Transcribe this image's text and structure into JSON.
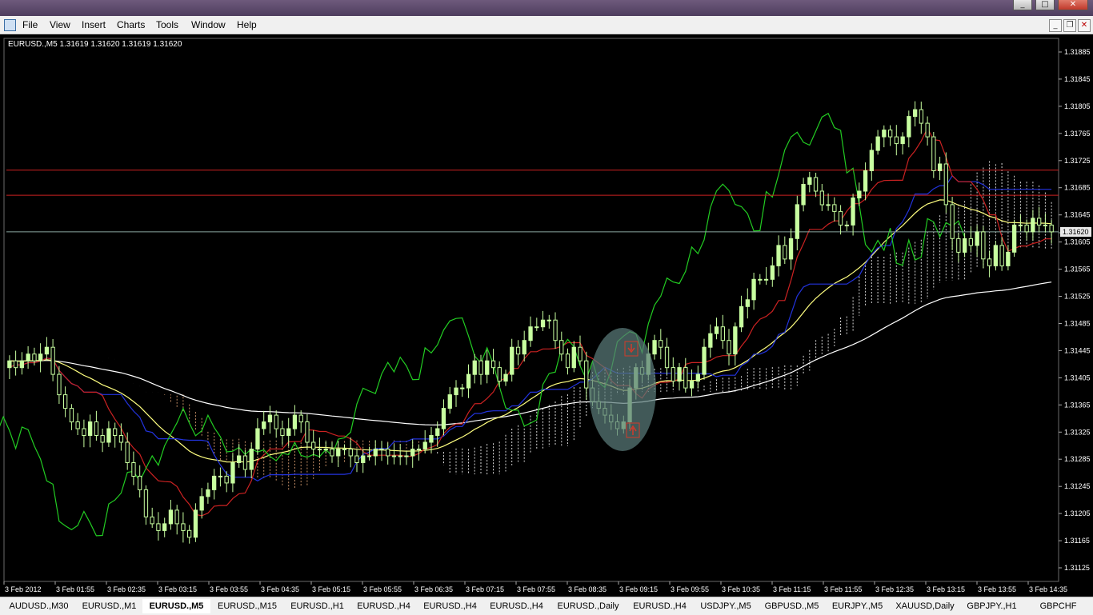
{
  "menu": [
    "File",
    "View",
    "Insert",
    "Charts",
    "Tools",
    "Window",
    "Help"
  ],
  "window_controls": {
    "minimize": "_",
    "maximize": "□",
    "close": "✕"
  },
  "mdi_controls": {
    "minimize": "_",
    "restore": "❐",
    "close": "✕"
  },
  "chart_header": "EURUSD.,M5  1.31619 1.31620 1.31619 1.31620",
  "price_axis": [
    "1.31885",
    "1.31845",
    "1.31805",
    "1.31765",
    "1.31725",
    "1.31685",
    "1.31645",
    "1.31605",
    "1.31565",
    "1.31525",
    "1.31485",
    "1.31445",
    "1.31405",
    "1.31365",
    "1.31325",
    "1.31285",
    "1.31245",
    "1.31205",
    "1.31165",
    "1.31125"
  ],
  "current_price": "1.31620",
  "horizontal_lines": [
    1.31711,
    1.31674
  ],
  "time_axis": [
    "3 Feb 2012",
    "3 Feb 01:55",
    "3 Feb 02:35",
    "3 Feb 03:15",
    "3 Feb 03:55",
    "3 Feb 04:35",
    "3 Feb 05:15",
    "3 Feb 05:55",
    "3 Feb 06:35",
    "3 Feb 07:15",
    "3 Feb 07:55",
    "3 Feb 08:35",
    "3 Feb 09:15",
    "3 Feb 09:55",
    "3 Feb 10:35",
    "3 Feb 11:15",
    "3 Feb 11:55",
    "3 Feb 12:35",
    "3 Feb 13:15",
    "3 Feb 13:55",
    "3 Feb 14:35"
  ],
  "tabs": [
    "AUDUSD.,M30",
    "EURUSD.,M1",
    "EURUSD.,M5",
    "EURUSD.,M15",
    "EURUSD.,H1",
    "EURUSD.,H4",
    "EURUSD.,H4",
    "EURUSD.,H4",
    "EURUSD.,Daily",
    "EURUSD.,H4",
    "USDJPY.,M5",
    "GBPUSD.,M5",
    "EURJPY.,M5",
    "XAUUSD,Daily",
    "GBPJPY.,H1",
    "GBPCHF"
  ],
  "active_tab": 2,
  "colors": {
    "background": "#000000",
    "bull_candle": "#c8ffa0",
    "chikou": "#22cc22",
    "tenkan": "#cc2222",
    "kijun": "#2233dd",
    "ma_fast": "#ffff80",
    "ma_slow": "#ffffff",
    "hline": "#cc2222",
    "current_price_line": "#8aa6a0"
  },
  "chart_data": {
    "type": "candlestick",
    "symbol": "EURUSD.",
    "timeframe": "M5",
    "ylim": [
      1.31105,
      1.31905
    ],
    "last_price": 1.3162,
    "closes": [
      1.3143,
      1.3142,
      1.3143,
      1.3144,
      1.3143,
      1.3144,
      1.3145,
      1.3141,
      1.3138,
      1.3136,
      1.3134,
      1.3133,
      1.3132,
      1.3134,
      1.3132,
      1.3131,
      1.3133,
      1.3132,
      1.3131,
      1.3128,
      1.3126,
      1.3124,
      1.312,
      1.3119,
      1.3118,
      1.3119,
      1.3121,
      1.3119,
      1.3118,
      1.3117,
      1.3121,
      1.3123,
      1.3124,
      1.3126,
      1.3126,
      1.3125,
      1.3128,
      1.3129,
      1.3127,
      1.313,
      1.3133,
      1.3134,
      1.3135,
      1.3133,
      1.3132,
      1.3133,
      1.3135,
      1.3134,
      1.3131,
      1.313,
      1.313,
      1.313,
      1.3129,
      1.313,
      1.313,
      1.3129,
      1.3128,
      1.3129,
      1.3129,
      1.313,
      1.313,
      1.3129,
      1.3129,
      1.3129,
      1.3129,
      1.313,
      1.313,
      1.3131,
      1.3132,
      1.3133,
      1.3136,
      1.3138,
      1.3139,
      1.3139,
      1.3141,
      1.3143,
      1.3141,
      1.3143,
      1.3142,
      1.314,
      1.3141,
      1.3145,
      1.3144,
      1.3146,
      1.3148,
      1.3148,
      1.3149,
      1.3149,
      1.3146,
      1.3144,
      1.3142,
      1.3145,
      1.3143,
      1.3139,
      1.3137,
      1.3136,
      1.3135,
      1.3134,
      1.3133,
      1.3134,
      1.3139,
      1.3142,
      1.3141,
      1.3144,
      1.3146,
      1.3145,
      1.3142,
      1.314,
      1.3142,
      1.3139,
      1.314,
      1.3141,
      1.3145,
      1.3147,
      1.3148,
      1.3146,
      1.3144,
      1.3148,
      1.3151,
      1.3152,
      1.3155,
      1.3155,
      1.3155,
      1.3157,
      1.316,
      1.3158,
      1.3161,
      1.3166,
      1.3169,
      1.317,
      1.3168,
      1.3166,
      1.3166,
      1.3165,
      1.3163,
      1.3163,
      1.3167,
      1.3168,
      1.3171,
      1.3174,
      1.3176,
      1.3177,
      1.3176,
      1.3175,
      1.3176,
      1.3179,
      1.318,
      1.3178,
      1.3176,
      1.3171,
      1.3172,
      1.3166,
      1.3161,
      1.3159,
      1.3161,
      1.316,
      1.3162,
      1.3158,
      1.3157,
      1.316,
      1.3157,
      1.3159,
      1.3163,
      1.3163,
      1.3162,
      1.3164,
      1.3163,
      1.3163,
      1.3162
    ],
    "indicators": [
      "Ichimoku Kinko Hyo",
      "Moving Average (fast)",
      "Moving Average (slow)"
    ]
  }
}
